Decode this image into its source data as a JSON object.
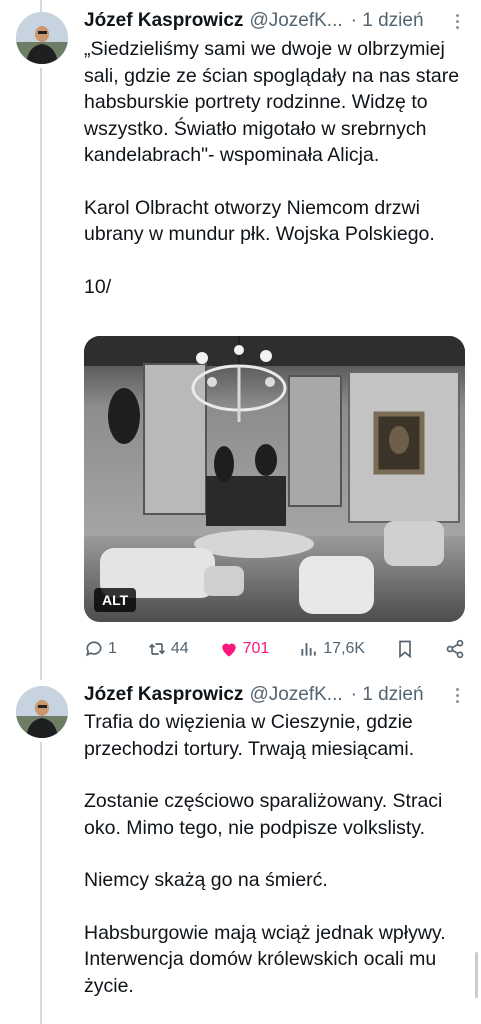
{
  "tweets": [
    {
      "author_name": "Józef Kasprowicz",
      "handle": "@JozefK...",
      "time": "· 1 dzień",
      "paragraphs": [
        "„Siedzieliśmy sami we dwoje w olbrzymiej sali, gdzie ze ścian spoglądały na nas stare habsburskie portrety rodzinne. Widzę to wszystko. Światło migotało w srebrnych kandelabrach\"- wspominała Alicja.",
        "Karol Olbracht otworzy Niemcom drzwi ubrany w mundur płk. Wojska Polskiego.",
        "10/"
      ],
      "media": {
        "alt_badge": "ALT",
        "description_icon": "photo-salon"
      },
      "actions": {
        "replies": "1",
        "retweets": "44",
        "likes": "701",
        "views": "17,6K"
      }
    },
    {
      "author_name": "Józef Kasprowicz",
      "handle": "@JozefK...",
      "time": "· 1 dzień",
      "paragraphs": [
        "Trafia do więzienia w Cieszynie, gdzie przechodzi tortury. Trwają miesiącami.",
        "Zostanie częściowo sparaliżowany. Straci oko. Mimo tego, nie podpisze volkslisty.",
        "Niemcy skażą go na śmierć.",
        "Habsburgowie mają wciąż jednak wpływy. Interwencja domów królewskich ocali mu życie."
      ]
    }
  ],
  "colors": {
    "text": "#0f1419",
    "muted": "#536471",
    "like": "#f91880",
    "thread": "#cfd9de"
  }
}
